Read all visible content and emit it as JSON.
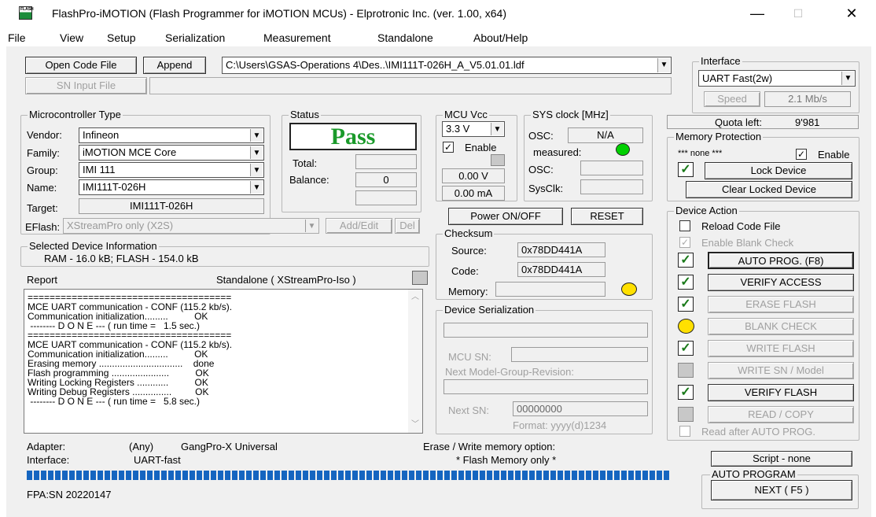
{
  "window": {
    "icon_text": "FLASH",
    "title": "FlashPro-iMOTION (Flash Programmer for iMOTION MCUs) - Elprotronic Inc. (ver. 1.00, x64)",
    "minimize": "—",
    "maximize": "☐",
    "close": "✕"
  },
  "menu": [
    "File",
    "View",
    "Setup",
    "Serialization",
    "Measurement",
    "Standalone",
    "About/Help"
  ],
  "toolbar": {
    "open_code_file": "Open Code File",
    "append": "Append",
    "code_path": "C:\\Users\\GSAS-Operations 4\\Des..\\IMI111T-026H_A_V5.01.01.ldf",
    "sn_input_file": "SN Input File",
    "sn_input_value": ""
  },
  "interface": {
    "label": "Interface",
    "value": "UART Fast(2w)",
    "speed_button": "Speed",
    "speed_value": "2.1 Mb/s"
  },
  "quota": {
    "label": "Quota left:",
    "value": "9'981"
  },
  "mcu": {
    "group": "Microcontroller Type",
    "vendor_label": "Vendor:",
    "vendor": "Infineon",
    "family_label": "Family:",
    "family": "iMOTION MCE Core",
    "group_label": "Group:",
    "group_value": "IMI 111",
    "name_label": "Name:",
    "name": "IMI111T-026H",
    "target_label": "Target:",
    "target": "IMI111T-026H",
    "eflash_label": "EFlash:",
    "eflash": "XStreamPro only (X2S)",
    "add_edit": "Add/Edit",
    "del": "Del"
  },
  "status": {
    "group": "Status",
    "result": "Pass",
    "total_label": "Total:",
    "total": "",
    "balance_label": "Balance:",
    "balance": "0",
    "extra": ""
  },
  "vcc": {
    "group": "MCU Vcc",
    "value": "3.3 V",
    "enable": "Enable",
    "volts": "0.00 V",
    "amps": "0.00 mA"
  },
  "sysclock": {
    "group": "SYS clock [MHz]",
    "osc_label": "OSC:",
    "osc": "N/A",
    "measured_label": "measured:",
    "osc2_label": "OSC:",
    "osc2": "",
    "sysclk_label": "SysClk:",
    "sysclk": ""
  },
  "power": {
    "power_button": "Power ON/OFF",
    "reset_button": "RESET"
  },
  "memory_protection": {
    "group": "Memory Protection",
    "none": "*** none ***",
    "enable": "Enable",
    "lock": "Lock Device",
    "clear": "Clear Locked Device"
  },
  "device_info": {
    "group": "Selected Device Information",
    "text": "RAM -  16.0 kB;  FLASH - 154.0 kB"
  },
  "report": {
    "label": "Report",
    "standalone": "Standalone ( XStreamPro-Iso )",
    "lines": [
      "=====================================",
      "MCE UART communication - CONF (115.2 kb/s).",
      "Communication initialization.........          OK",
      " -------- D O N E --- ( run time =   1.5 sec.)",
      "=====================================",
      "MCE UART communication - CONF (115.2 kb/s).",
      "Communication initialization.........          OK",
      "Erasing memory ................................    done",
      "Flash programming ......................          OK",
      "Writing Locking Registers ............          OK",
      "Writing Debug Registers ...............         OK",
      " -------- D O N E --- ( run time =   5.8 sec.)"
    ]
  },
  "checksum": {
    "group": "Checksum",
    "source_label": "Source:",
    "source": "0x78DD441A",
    "code_label": "Code:",
    "code": "0x78DD441A",
    "memory_label": "Memory:",
    "memory": ""
  },
  "serialization": {
    "group": "Device Serialization",
    "field1": "",
    "mcu_sn_label": "MCU SN:",
    "mcu_sn": "",
    "next_model_label": "Next Model-Group-Revision:",
    "next_model": "",
    "next_sn_label": "Next SN:",
    "next_sn": "00000000",
    "format": "Format: yyyy(d)1234"
  },
  "device_action": {
    "group": "Device Action",
    "reload": "Reload Code File",
    "blank_check_enable": "Enable Blank Check",
    "auto_prog": "AUTO PROG. (F8)",
    "verify_access": "VERIFY ACCESS",
    "erase_flash": "ERASE FLASH",
    "blank_check": "BLANK CHECK",
    "write_flash": "WRITE FLASH",
    "write_sn": "WRITE SN / Model",
    "verify_flash": "VERIFY FLASH",
    "read_copy": "READ / COPY",
    "read_after": "Read after AUTO PROG."
  },
  "footer": {
    "adapter_label": "Adapter:",
    "adapter_any": "(Any)",
    "adapter": "GangPro-X Universal",
    "interface_label": "Interface:",
    "interface": "UART-fast",
    "erase_option_label": "Erase / Write memory option:",
    "erase_option": "* Flash Memory only *",
    "script": "Script - none",
    "auto_program": "AUTO PROGRAM",
    "next": "NEXT  ( F5 )",
    "fpa_sn": "FPA:SN 20220147",
    "progress_percent": 100
  },
  "colors": {
    "pass": "#1a9a2a",
    "led_green": "#00d000",
    "led_yellow": "#ffe000",
    "progress": "#1565c0",
    "check_green": "#1a7a1a"
  }
}
